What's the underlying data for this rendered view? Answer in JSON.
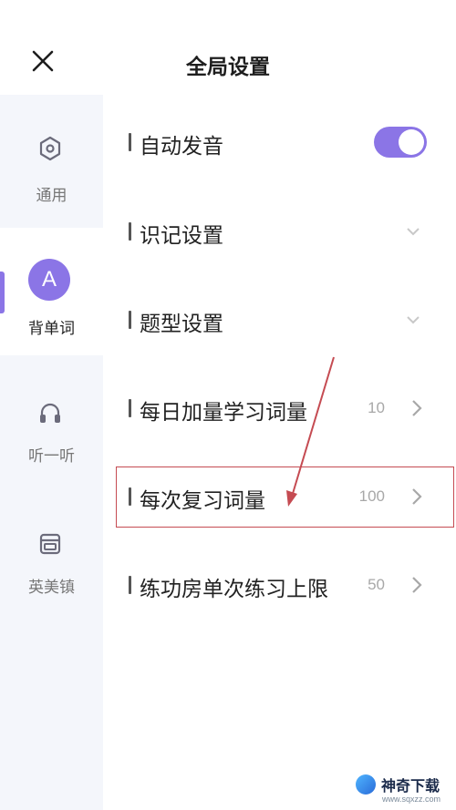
{
  "header": {
    "title": "全局设置"
  },
  "sidebar": {
    "items": [
      {
        "label": "通用",
        "icon": "settings-hex-icon"
      },
      {
        "label": "背单词",
        "icon": "letter-a-avatar",
        "avatar_letter": "A",
        "active": true
      },
      {
        "label": "听一听",
        "icon": "headphones-icon"
      },
      {
        "label": "英美镇",
        "icon": "town-box-icon"
      }
    ]
  },
  "settings": {
    "auto_pronounce": {
      "label": "自动发音",
      "enabled": true
    },
    "memory": {
      "label": "识记设置"
    },
    "question_type": {
      "label": "题型设置"
    },
    "daily_add": {
      "label": "每日加量学习词量",
      "value": "10"
    },
    "review_count": {
      "label": "每次复习词量",
      "value": "100"
    },
    "practice_limit": {
      "label": "练功房单次练习上限",
      "value": "50"
    }
  },
  "watermark": {
    "name": "神奇下载",
    "url": "www.sqxzz.com"
  },
  "colors": {
    "accent": "#8b75e6",
    "highlight_box": "#c54b52",
    "sidebar_bg": "#f4f6fb"
  }
}
